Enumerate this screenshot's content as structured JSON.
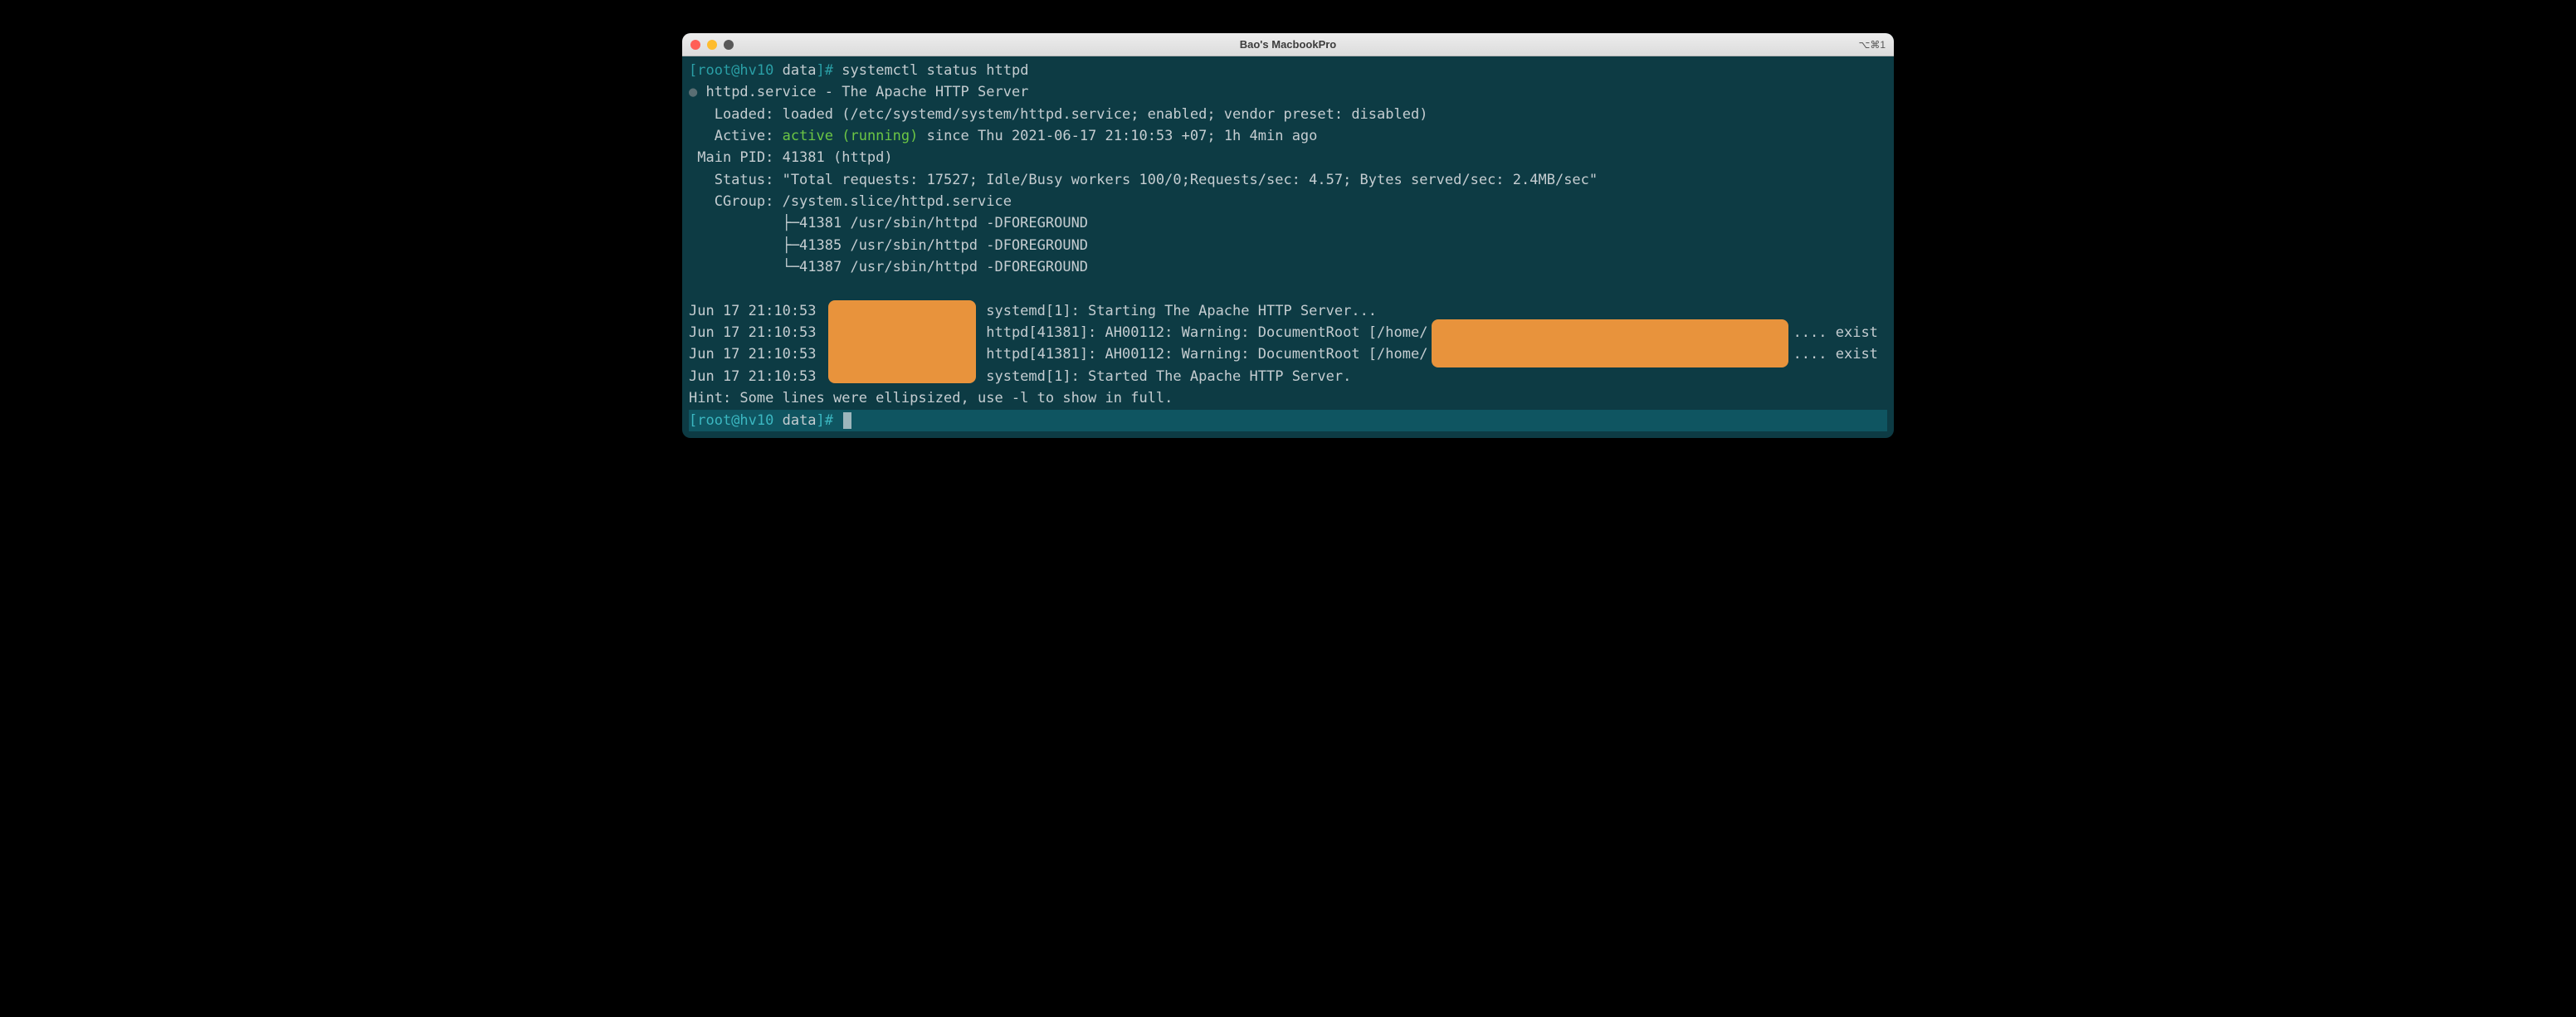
{
  "window": {
    "title": "Bao's MacbookPro",
    "shortcut": "⌥⌘1"
  },
  "prompt": {
    "user_host": "[root@hv10 ",
    "path": "data",
    "suffix": "]# ",
    "command": "systemctl status httpd"
  },
  "status": {
    "bullet": "●",
    "service_line": " httpd.service - The Apache HTTP Server",
    "loaded": "   Loaded: loaded (/etc/systemd/system/httpd.service; enabled; vendor preset: disabled)",
    "active_label": "   Active: ",
    "active_value": "active (running)",
    "active_rest": " since Thu 2021-06-17 21:10:53 +07; 1h 4min ago",
    "main_pid": " Main PID: 41381 (httpd)",
    "status_line": "   Status: \"Total requests: 17527; Idle/Busy workers 100/0;Requests/sec: 4.57; Bytes served/sec: 2.4MB/sec\"",
    "cgroup": "   CGroup: /system.slice/httpd.service",
    "proc1": "           ├─41381 /usr/sbin/httpd -DFOREGROUND",
    "proc2": "           ├─41385 /usr/sbin/httpd -DFOREGROUND",
    "proc3": "           └─41387 /usr/sbin/httpd -DFOREGROUND"
  },
  "logs": {
    "l1_pre": "Jun 17 21:10:53 ",
    "l1_post": " systemd[1]: Starting The Apache HTTP Server...",
    "l2_pre": "Jun 17 21:10:53 ",
    "l2_mid": " httpd[41381]: AH00112: Warning: DocumentRoot [/home/",
    "l2_end": ".... exist",
    "l3_pre": "Jun 17 21:10:53 ",
    "l3_mid": " httpd[41381]: AH00112: Warning: DocumentRoot [/home/",
    "l3_end": ".... exist",
    "l4_pre": "Jun 17 21:10:53 ",
    "l4_post": " systemd[1]: Started The Apache HTTP Server."
  },
  "hint": "Hint: Some lines were ellipsized, use -l to show in full.",
  "prompt2": {
    "user_host": "[root@hv10 ",
    "path": "data",
    "suffix": "]# "
  }
}
